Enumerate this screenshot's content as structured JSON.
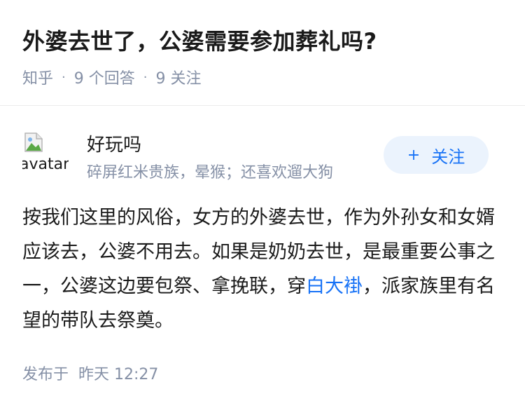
{
  "question": {
    "title": "外婆去世了，公婆需要参加葬礼吗?",
    "source": "知乎",
    "separator": "·",
    "answer_count": "9 个回答",
    "follower_count": "9 关注"
  },
  "author": {
    "avatar_alt": "avatar",
    "name": "好玩吗",
    "bio": "碎屏红米贵族，晕猴；还喜欢遛大狗",
    "follow_label": "关注",
    "follow_icon": "plus-icon"
  },
  "answer": {
    "text_before_link": "按我们这里的风俗，女方的外婆去世，作为外孙女和女婿应该去，公婆不用去。如果是奶奶去世，是最重要公事之一，公婆这边要包祭、拿挽联，穿",
    "link_text": "白大褂",
    "text_after_link": "，派家族里有名望的带队去祭奠。"
  },
  "footer": {
    "published_label": "发布于",
    "published_time": "昨天 12:27"
  },
  "colors": {
    "accent": "#1772f6",
    "muted": "#8590a6",
    "follow_bg": "#ebf3fd",
    "text": "#1a1a1a"
  }
}
